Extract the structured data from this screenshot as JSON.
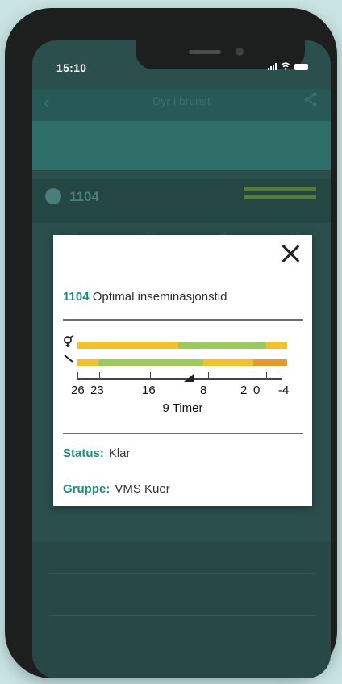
{
  "status_bar": {
    "time": "15:10"
  },
  "background": {
    "title": "Dyr i brunst",
    "row_number": "1104",
    "scale": [
      "1",
      "20",
      "8",
      "18"
    ]
  },
  "modal": {
    "cow_id": "1104",
    "title": "Optimal inseminasjonstid",
    "scale_labels": [
      "26",
      "23",
      "16",
      "8",
      "2",
      "0",
      "-4"
    ],
    "timer_text": "9 Timer",
    "status_label": "Status:",
    "status_value": "Klar",
    "group_label": "Gruppe:",
    "group_value": "VMS Kuer"
  },
  "colors": {
    "accent": "#1b8b82",
    "yellow": "#f4c12e",
    "green": "#9cc95c",
    "orange": "#e59a2d"
  }
}
